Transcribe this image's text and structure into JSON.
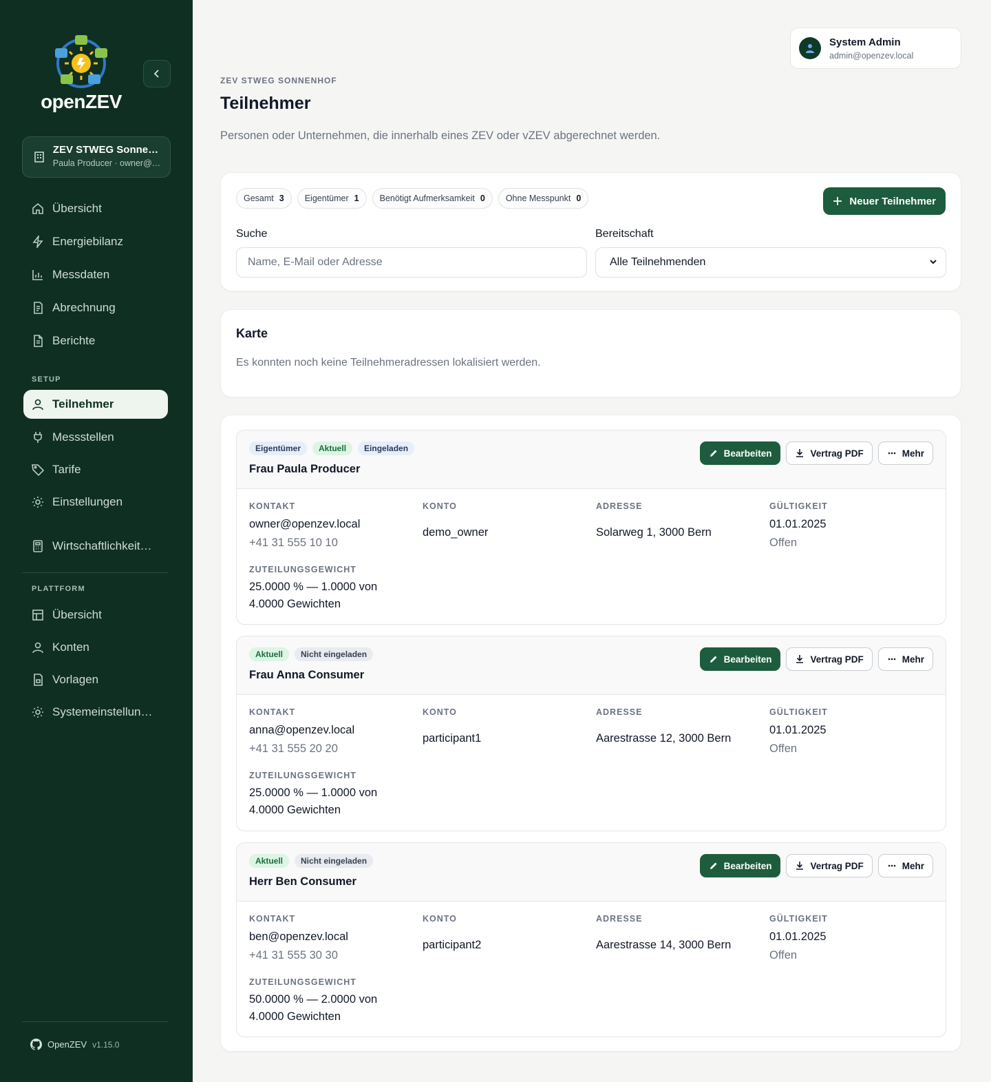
{
  "sidebar": {
    "logo_text": "openZEV",
    "org": {
      "name": "ZEV STWEG Sonnenhof",
      "sub": "Paula Producer · owner@openzev.local"
    },
    "main_items": [
      {
        "label": "Übersicht",
        "icon": "home-icon"
      },
      {
        "label": "Energiebilanz",
        "icon": "bolt-icon"
      },
      {
        "label": "Messdaten",
        "icon": "bar-chart-icon"
      },
      {
        "label": "Abrechnung",
        "icon": "invoice-icon"
      },
      {
        "label": "Berichte",
        "icon": "report-icon"
      }
    ],
    "setup_title": "SETUP",
    "setup_items": [
      {
        "label": "Teilnehmer",
        "icon": "user-icon",
        "active": true
      },
      {
        "label": "Messstellen",
        "icon": "plug-icon"
      },
      {
        "label": "Tarife",
        "icon": "tag-icon"
      },
      {
        "label": "Einstellungen",
        "icon": "gear-icon"
      },
      {
        "label": "Wirtschaftlichkeitsrechner",
        "icon": "calculator-icon"
      }
    ],
    "platform_title": "PLATTFORM",
    "platform_items": [
      {
        "label": "Übersicht",
        "icon": "dashboard-icon"
      },
      {
        "label": "Konten",
        "icon": "users-icon"
      },
      {
        "label": "Vorlagen",
        "icon": "template-icon"
      },
      {
        "label": "Systemeinstellungen",
        "icon": "gear-icon"
      }
    ],
    "footer_name": "OpenZEV",
    "footer_version": "v1.15.0"
  },
  "user": {
    "name": "System Admin",
    "email": "admin@openzev.local"
  },
  "header": {
    "eyebrow": "ZEV STWEG SONNENHOF",
    "title": "Teilnehmer",
    "description": "Personen oder Unternehmen, die innerhalb eines ZEV oder vZEV abgerechnet werden."
  },
  "filters": {
    "chips": [
      {
        "label": "Gesamt",
        "count": "3"
      },
      {
        "label": "Eigentümer",
        "count": "1"
      },
      {
        "label": "Benötigt Aufmerksamkeit",
        "count": "0"
      },
      {
        "label": "Ohne Messpunkt",
        "count": "0"
      }
    ],
    "new_button": "Neuer Teilnehmer",
    "search_label": "Suche",
    "search_placeholder": "Name, E-Mail oder Adresse",
    "readiness_label": "Bereitschaft",
    "readiness_value": "Alle Teilnehmenden"
  },
  "map": {
    "title": "Karte",
    "empty_text": "Es konnten noch keine Teilnehmeradressen lokalisiert werden."
  },
  "columns": {
    "contact": "KONTAKT",
    "account": "KONTO",
    "address": "ADRESSE",
    "validity": "GÜLTIGKEIT",
    "weight": "ZUTEILUNGSGEWICHT"
  },
  "actions": {
    "edit": "Bearbeiten",
    "contract": "Vertrag PDF",
    "more": "Mehr"
  },
  "participants": [
    {
      "badges": [
        {
          "text": "Eigentümer",
          "tone": "blue"
        },
        {
          "text": "Aktuell",
          "tone": "green"
        },
        {
          "text": "Eingeladen",
          "tone": "blue"
        }
      ],
      "name": "Frau Paula Producer",
      "email": "owner@openzev.local",
      "phone": "+41 31 555 10 10",
      "account": "demo_owner",
      "address": "Solarweg 1, 3000 Bern",
      "valid_from": "01.01.2025",
      "valid_to": "Offen",
      "weight": "25.0000 % — 1.0000 von 4.0000 Gewichten"
    },
    {
      "badges": [
        {
          "text": "Aktuell",
          "tone": "green"
        },
        {
          "text": "Nicht eingeladen",
          "tone": "gray"
        }
      ],
      "name": "Frau Anna Consumer",
      "email": "anna@openzev.local",
      "phone": "+41 31 555 20 20",
      "account": "participant1",
      "address": "Aarestrasse 12, 3000 Bern",
      "valid_from": "01.01.2025",
      "valid_to": "Offen",
      "weight": "25.0000 % — 1.0000 von 4.0000 Gewichten"
    },
    {
      "badges": [
        {
          "text": "Aktuell",
          "tone": "green"
        },
        {
          "text": "Nicht eingeladen",
          "tone": "gray"
        }
      ],
      "name": "Herr Ben Consumer",
      "email": "ben@openzev.local",
      "phone": "+41 31 555 30 30",
      "account": "participant2",
      "address": "Aarestrasse 14, 3000 Bern",
      "valid_from": "01.01.2025",
      "valid_to": "Offen",
      "weight": "50.0000 % — 2.0000 von 4.0000 Gewichten"
    }
  ]
}
